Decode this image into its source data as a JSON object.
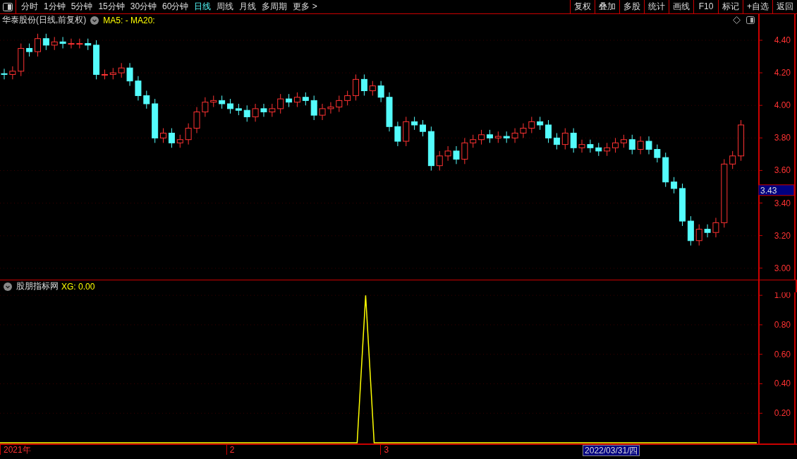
{
  "toolbar": {
    "tabs": [
      {
        "label": "分时",
        "selected": false
      },
      {
        "label": "1分钟",
        "selected": false
      },
      {
        "label": "5分钟",
        "selected": false
      },
      {
        "label": "15分钟",
        "selected": false
      },
      {
        "label": "30分钟",
        "selected": false
      },
      {
        "label": "60分钟",
        "selected": false
      },
      {
        "label": "日线",
        "selected": true
      },
      {
        "label": "周线",
        "selected": false
      },
      {
        "label": "月线",
        "selected": false
      },
      {
        "label": "多周期",
        "selected": false
      },
      {
        "label": "更多 >",
        "selected": false
      }
    ],
    "buttons": [
      "复权",
      "叠加",
      "多股",
      "统计",
      "画线",
      "F10",
      "标记",
      "+自选",
      "返回"
    ]
  },
  "price_panel": {
    "title": "华泰股份(日线,前复权)",
    "indicators": "MA5: -  MA20:",
    "axis_labels": [
      "4.40",
      "4.20",
      "4.00",
      "3.80",
      "3.60",
      "3.40",
      "3.20",
      "3.00"
    ],
    "last_price": "3.43"
  },
  "indicator_panel": {
    "name": "股朋指标网",
    "reading": "XG: 0.00",
    "chart_data": {
      "type": "line",
      "ylim": [
        0,
        1.02
      ],
      "grid": true,
      "yticks": [
        {
          "value": 0.2,
          "label": "0.20"
        },
        {
          "value": 0.4,
          "label": "0.40"
        },
        {
          "value": 0.6,
          "label": "0.60"
        },
        {
          "value": 0.8,
          "label": "0.80"
        },
        {
          "value": 1,
          "label": "1.00"
        }
      ],
      "series": [
        {
          "color": "#ffff00",
          "values": [
            0,
            0,
            0,
            0,
            0,
            0,
            0,
            0,
            0,
            0,
            0,
            0,
            0,
            0,
            0,
            0,
            0,
            0,
            0,
            0,
            0,
            0,
            0,
            0,
            0,
            0,
            0,
            0,
            0,
            0,
            0,
            0,
            0,
            0,
            0,
            0,
            0,
            0,
            0,
            0,
            0,
            0,
            0,
            1,
            0,
            0,
            0,
            0,
            0,
            0,
            0,
            0,
            0,
            0,
            0,
            0,
            0,
            0,
            0,
            0,
            0,
            0,
            0,
            0,
            0,
            0,
            0,
            0,
            0,
            0,
            0,
            0,
            0,
            0,
            0,
            0,
            0,
            0,
            0,
            0,
            0,
            0,
            0,
            0,
            0,
            0,
            0,
            0,
            0,
            0
          ]
        }
      ]
    }
  },
  "date_bar": {
    "labels": [
      "2021年",
      "2",
      "3"
    ],
    "cursor_date": "2022/03/31/四"
  }
}
